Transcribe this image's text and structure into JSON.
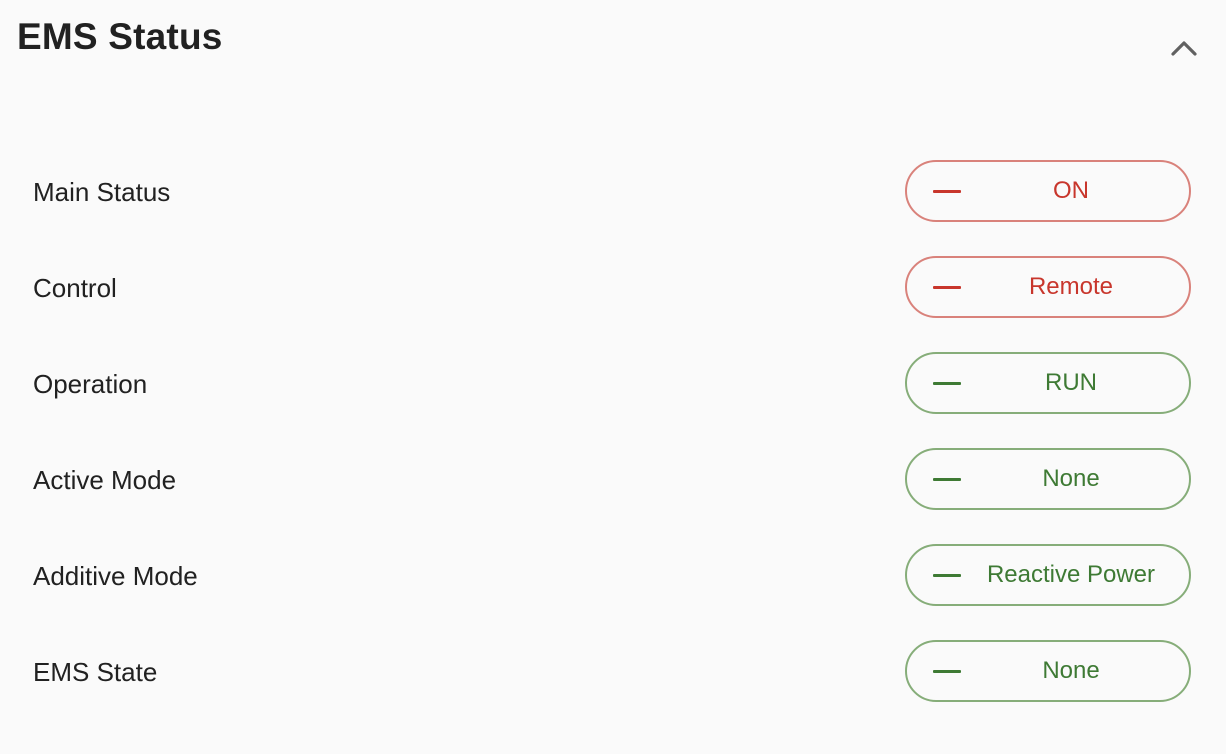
{
  "panel": {
    "title": "EMS Status",
    "collapse_icon": "chevron-up-icon"
  },
  "colors": {
    "alert_text": "#c8362c",
    "alert_border": "#d9827b",
    "ok_text": "#3e7a34",
    "ok_border": "#86ad79"
  },
  "rows": [
    {
      "label": "Main Status",
      "value": "ON",
      "state": "red",
      "icon": "dash-icon"
    },
    {
      "label": "Control",
      "value": "Remote",
      "state": "red",
      "icon": "dash-icon"
    },
    {
      "label": "Operation",
      "value": "RUN",
      "state": "green",
      "icon": "dash-icon"
    },
    {
      "label": "Active Mode",
      "value": "None",
      "state": "green",
      "icon": "dash-icon"
    },
    {
      "label": "Additive Mode",
      "value": "Reactive Power",
      "state": "green",
      "icon": "dash-icon"
    },
    {
      "label": "EMS State",
      "value": "None",
      "state": "green",
      "icon": "dash-icon"
    }
  ]
}
